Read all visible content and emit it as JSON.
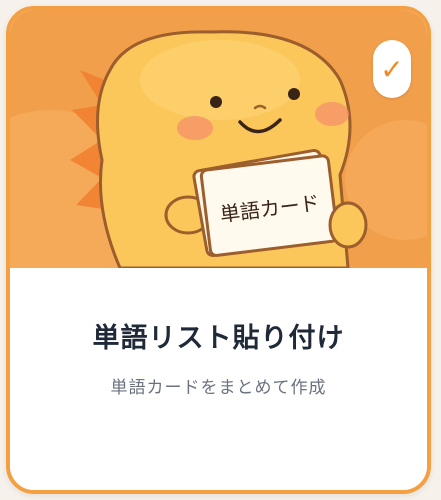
{
  "card": {
    "title": "単語リスト貼り付け",
    "subtitle": "単語カードをまとめて作成",
    "selected_mark": "✓",
    "illustration_card_text": "単語カード",
    "accent_color": "#f4a042",
    "illustration_bg": "#f29f4b"
  }
}
